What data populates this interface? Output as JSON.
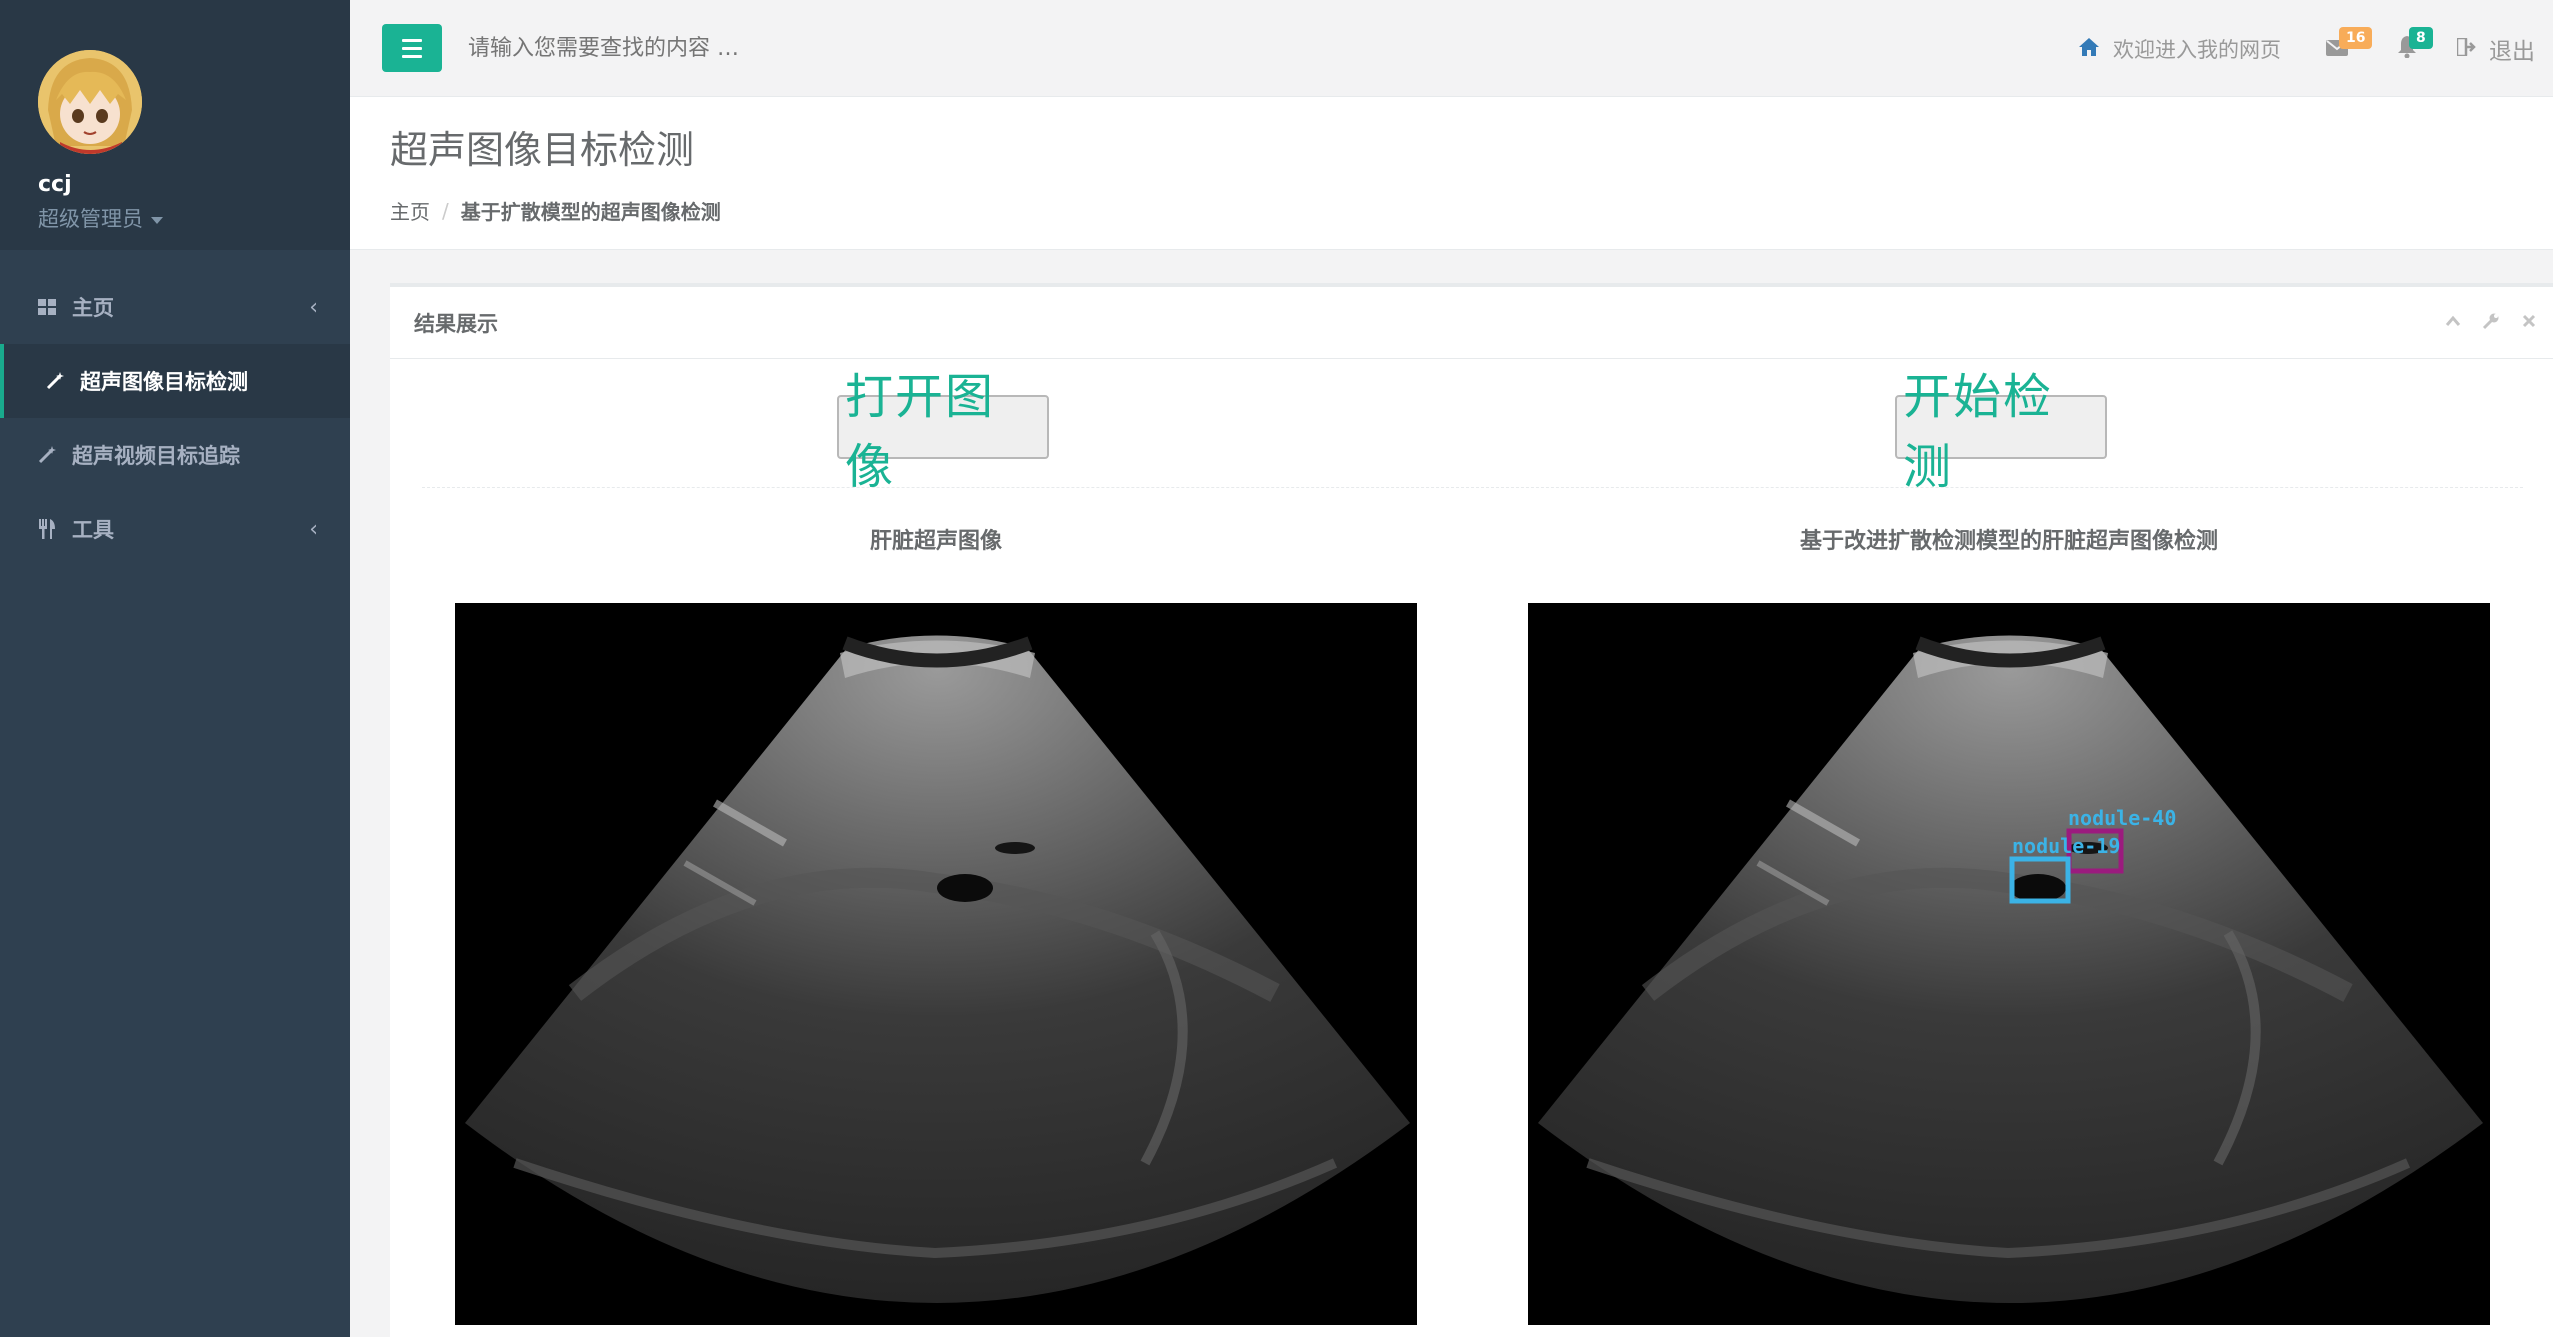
{
  "user": {
    "name": "ccj",
    "role": "超级管理员"
  },
  "sidebar": {
    "items": [
      {
        "label": "主页",
        "icon": "grid-icon",
        "has_chevron": true
      },
      {
        "label": "超声图像目标检测",
        "icon": "magic-wand-icon",
        "active": true
      },
      {
        "label": "超声视频目标追踪",
        "icon": "magic-wand-icon"
      },
      {
        "label": "工具",
        "icon": "cutlery-icon",
        "has_chevron": true
      }
    ]
  },
  "topbar": {
    "search_placeholder": "请输入您需要查找的内容 …",
    "welcome": "欢迎进入我的网页",
    "mail_count": "16",
    "alert_count": "8",
    "logout": "退出"
  },
  "heading": {
    "title": "超声图像目标检测",
    "breadcrumb_home": "主页",
    "breadcrumb_current": "基于扩散模型的超声图像检测"
  },
  "panel": {
    "title": "结果展示",
    "open_button": "打开图像",
    "detect_button": "开始检测",
    "left_caption": "肝脏超声图像",
    "right_caption": "基于改进扩散检测模型的肝脏超声图像检测",
    "detections": [
      {
        "label": "nodule-40",
        "color": "#9b1b7e"
      },
      {
        "label": "nodule-19",
        "color": "#3bb3e6"
      }
    ]
  },
  "colors": {
    "accent": "#1ab394",
    "sidebar": "#2f4050",
    "badge_orange": "#f8ac59"
  }
}
